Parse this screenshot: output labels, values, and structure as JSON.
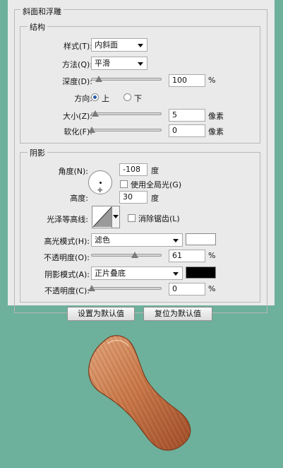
{
  "bevel": {
    "title": "斜面和浮雕",
    "structure": {
      "title": "结构",
      "style": {
        "label": "样式(T):",
        "value": "内斜面"
      },
      "technique": {
        "label": "方法(Q):",
        "value": "平滑"
      },
      "depth": {
        "label": "深度(D):",
        "value": "100",
        "unit": "%",
        "fraction": 0.1
      },
      "direction": {
        "label": "方向:",
        "up": "上",
        "down": "下",
        "selected": "up"
      },
      "size": {
        "label": "大小(Z):",
        "value": "5",
        "unit": "像素",
        "fraction": 0.05
      },
      "soften": {
        "label": "软化(F):",
        "value": "0",
        "unit": "像素",
        "fraction": 0.0
      }
    },
    "shading": {
      "title": "阴影",
      "angle": {
        "label": "角度(N):",
        "value": "-108",
        "unit": "度"
      },
      "global_light": {
        "label": "使用全局光(G)",
        "checked": false
      },
      "altitude": {
        "label": "高度:",
        "value": "30",
        "unit": "度"
      },
      "gloss_contour": {
        "label": "光泽等高线:"
      },
      "anti_aliased": {
        "label": "消除锯齿(L)",
        "checked": false
      },
      "highlight_mode": {
        "label": "高光模式(H):",
        "value": "滤色",
        "color": "#ffffff"
      },
      "highlight_opacity": {
        "label": "不透明度(O):",
        "value": "61",
        "unit": "%",
        "fraction": 0.61
      },
      "shadow_mode": {
        "label": "阴影模式(A):",
        "value": "正片叠底",
        "color": "#000000"
      },
      "shadow_opacity": {
        "label": "不透明度(C):",
        "value": "0",
        "unit": "%",
        "fraction": 0.0
      }
    },
    "buttons": {
      "make_default": "设置为默认值",
      "reset_default": "复位为默认值"
    }
  },
  "colors": {
    "background": "#6db09b",
    "panel": "#eaeaea",
    "wood_light": "#d8956a",
    "wood_dark": "#a85530"
  },
  "icons": [
    "chevron-down-icon",
    "radio-icon",
    "checkbox-icon",
    "angle-dial-icon",
    "contour-curve-icon",
    "wood-shape-preview"
  ]
}
